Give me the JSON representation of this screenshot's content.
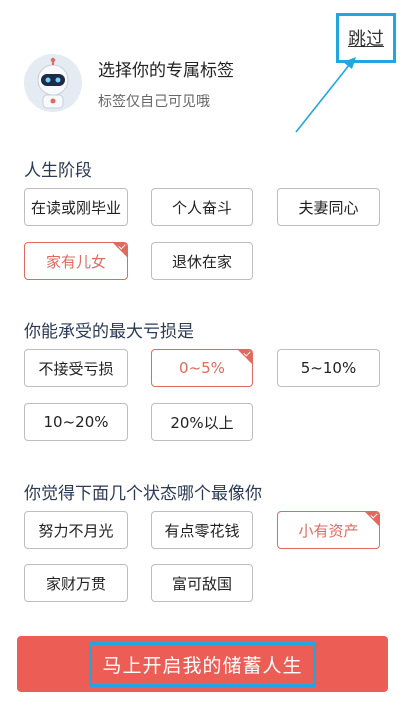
{
  "skip": {
    "label": "跳过"
  },
  "header": {
    "title": "选择你的专属标签",
    "subtitle": "标签仅自己可见哦"
  },
  "sections": [
    {
      "title": "人生阶段",
      "tags": [
        {
          "label": "在读或刚毕业",
          "selected": false
        },
        {
          "label": "个人奋斗",
          "selected": false
        },
        {
          "label": "夫妻同心",
          "selected": false
        },
        {
          "label": "家有儿女",
          "selected": true
        },
        {
          "label": "退休在家",
          "selected": false
        }
      ]
    },
    {
      "title": "你能承受的最大亏损是",
      "tags": [
        {
          "label": "不接受亏损",
          "selected": false
        },
        {
          "label": "0~5%",
          "selected": true
        },
        {
          "label": "5~10%",
          "selected": false
        },
        {
          "label": "10~20%",
          "selected": false
        },
        {
          "label": "20%以上",
          "selected": false
        }
      ]
    },
    {
      "title": "你觉得下面几个状态哪个最像你",
      "tags": [
        {
          "label": "努力不月光",
          "selected": false
        },
        {
          "label": "有点零花钱",
          "selected": false
        },
        {
          "label": "小有资产",
          "selected": true
        },
        {
          "label": "家财万贯",
          "selected": false
        },
        {
          "label": "富可敌国",
          "selected": false
        }
      ]
    }
  ],
  "cta": {
    "label": "马上开启我的储蓄人生"
  },
  "colors": {
    "accent": "#ec5e55",
    "selected": "#e06a5d",
    "highlight": "#21a6df"
  }
}
